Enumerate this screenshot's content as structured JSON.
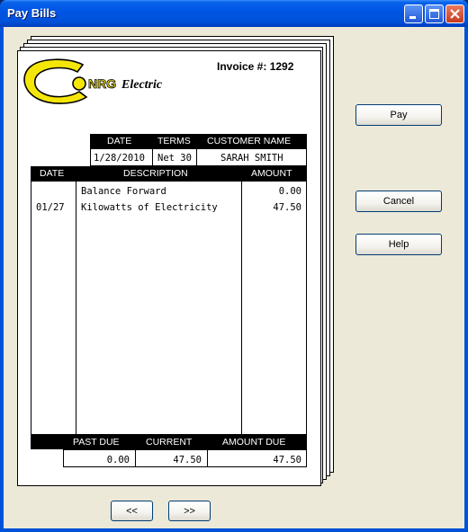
{
  "window": {
    "title": "Pay Bills"
  },
  "invoice": {
    "company_logo_text": "NRG Electric",
    "invoice_label": "Invoice #: 1292",
    "header": {
      "date_label": "DATE",
      "terms_label": "TERMS",
      "customer_label": "CUSTOMER NAME",
      "date": "1/28/2010",
      "terms": "Net 30",
      "customer": "SARAH SMITH"
    },
    "table": {
      "columns": [
        "DATE",
        "DESCRIPTION",
        "AMOUNT"
      ],
      "rows": [
        {
          "date": "",
          "description": "Balance Forward",
          "amount": "0.00"
        },
        {
          "date": "01/27",
          "description": "Kilowatts of Electricity",
          "amount": "47.50"
        }
      ]
    },
    "totals": {
      "past_due_label": "PAST DUE",
      "current_label": "CURRENT",
      "amount_due_label": "AMOUNT DUE",
      "past_due": "0.00",
      "current": "47.50",
      "amount_due": "47.50"
    }
  },
  "buttons": {
    "pay": "Pay",
    "cancel": "Cancel",
    "help": "Help",
    "prev": "<<",
    "next": ">>"
  },
  "colors": {
    "logo_yellow": "#f5e60a",
    "titlebar_blue": "#0052d9"
  }
}
